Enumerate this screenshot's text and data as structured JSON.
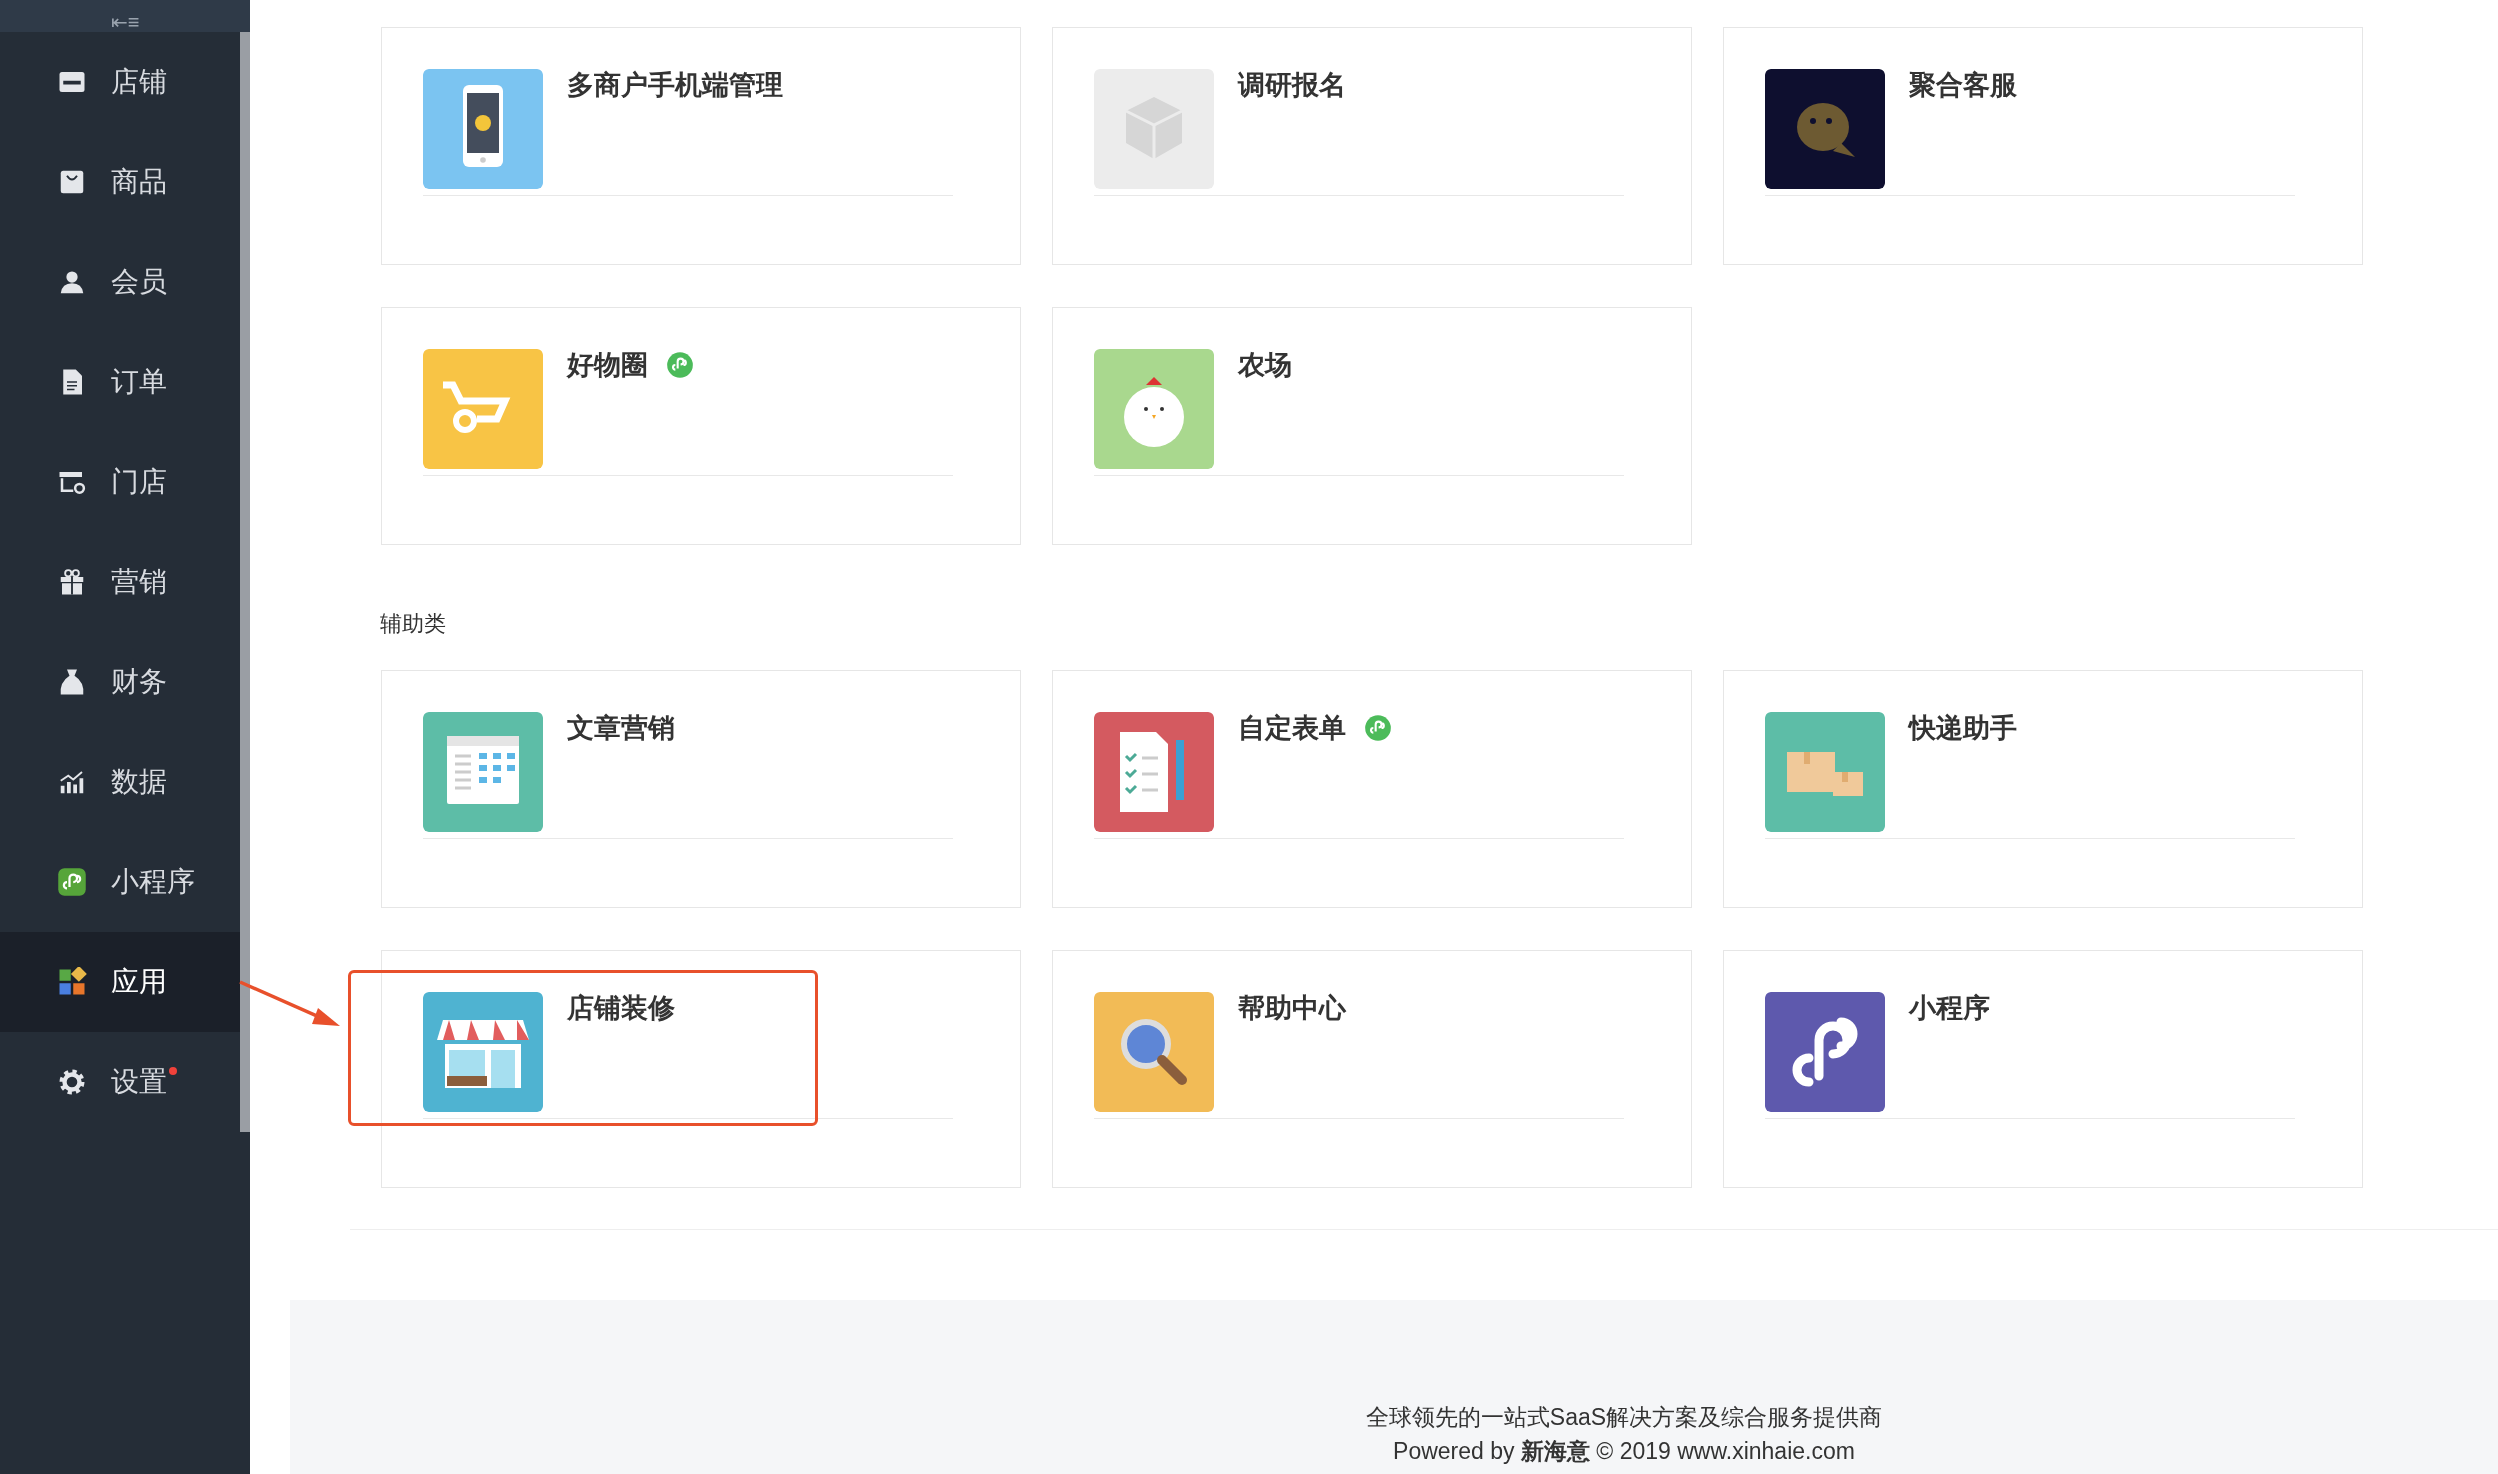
{
  "sidebar": {
    "collapse_icon": "⇤≡",
    "items": [
      {
        "label": "店铺",
        "kind": "store",
        "selected": false,
        "dot": false
      },
      {
        "label": "商品",
        "kind": "bag",
        "selected": false,
        "dot": false
      },
      {
        "label": "会员",
        "kind": "user",
        "selected": false,
        "dot": false
      },
      {
        "label": "订单",
        "kind": "doc",
        "selected": false,
        "dot": false
      },
      {
        "label": "门店",
        "kind": "shopgear",
        "selected": false,
        "dot": false
      },
      {
        "label": "营销",
        "kind": "gift",
        "selected": false,
        "dot": false
      },
      {
        "label": "财务",
        "kind": "money",
        "selected": false,
        "dot": false
      },
      {
        "label": "数据",
        "kind": "chart",
        "selected": false,
        "dot": false
      },
      {
        "label": "小程序",
        "kind": "mini",
        "selected": false,
        "dot": false
      },
      {
        "label": "应用",
        "kind": "apps",
        "selected": true,
        "dot": false
      },
      {
        "label": "设置",
        "kind": "gear",
        "selected": false,
        "dot": true
      }
    ]
  },
  "sections": [
    {
      "cards": [
        {
          "title": "多商户手机端管理",
          "kind": "phone",
          "mini_program": false,
          "highlighted": false
        },
        {
          "title": "调研报名",
          "kind": "box",
          "mini_program": false,
          "highlighted": false
        },
        {
          "title": "聚合客服",
          "kind": "chat",
          "mini_program": false,
          "highlighted": false
        },
        {
          "title": "好物圈",
          "kind": "cart",
          "mini_program": true,
          "highlighted": false
        },
        {
          "title": "农场",
          "kind": "chicken",
          "mini_program": false,
          "highlighted": false
        }
      ]
    },
    {
      "title": "辅助类",
      "cards": [
        {
          "title": "文章营销",
          "kind": "calendar",
          "mini_program": false,
          "highlighted": false
        },
        {
          "title": "自定表单",
          "kind": "form",
          "mini_program": true,
          "highlighted": false
        },
        {
          "title": "快递助手",
          "kind": "parcel",
          "mini_program": false,
          "highlighted": false
        },
        {
          "title": "店铺装修",
          "kind": "shop",
          "mini_program": false,
          "highlighted": true
        },
        {
          "title": "帮助中心",
          "kind": "search",
          "mini_program": false,
          "highlighted": false
        },
        {
          "title": "小程序",
          "kind": "link",
          "mini_program": false,
          "highlighted": false
        }
      ]
    }
  ],
  "footer": {
    "tagline": "全球领先的一站式SaaS解决方案及综合服务提供商",
    "powered": "Powered by **新海意** © 2019 www.xinhaie.com"
  }
}
